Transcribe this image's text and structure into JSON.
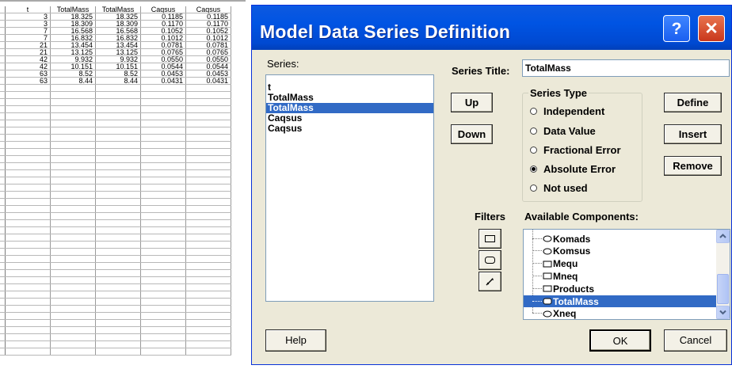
{
  "spreadsheet": {
    "headers": [
      "t",
      "TotalMass",
      "TotalMass",
      "Caqsus",
      "Caqsus"
    ],
    "rows": [
      [
        "3",
        "18.325",
        "18.325",
        "0.1185",
        "0.1185"
      ],
      [
        "3",
        "18.309",
        "18.309",
        "0.1170",
        "0.1170"
      ],
      [
        "7",
        "16.568",
        "16.568",
        "0.1052",
        "0.1052"
      ],
      [
        "7",
        "16.832",
        "16.832",
        "0.1012",
        "0.1012"
      ],
      [
        "21",
        "13.454",
        "13.454",
        "0.0781",
        "0.0781"
      ],
      [
        "21",
        "13.125",
        "13.125",
        "0.0765",
        "0.0765"
      ],
      [
        "42",
        "9.932",
        "9.932",
        "0.0550",
        "0.0550"
      ],
      [
        "42",
        "10.151",
        "10.151",
        "0.0544",
        "0.0544"
      ],
      [
        "63",
        "8.52",
        "8.52",
        "0.0453",
        "0.0453"
      ],
      [
        "63",
        "8.44",
        "8.44",
        "0.0431",
        "0.0431"
      ]
    ],
    "blank_rows": 38
  },
  "dialog": {
    "title": "Model Data Series Definition",
    "help_glyph": "?",
    "close_glyph": "✕",
    "title_color": "#0054e3",
    "close_color": "#d5482a",
    "series_label": "Series:",
    "series_items": [
      "t",
      "TotalMass",
      "TotalMass",
      "Caqsus",
      "Caqsus"
    ],
    "selected_series_index": 2,
    "up_label": "Up",
    "down_label": "Down",
    "series_title_label": "Series Title:",
    "series_title_value": "TotalMass",
    "series_type": {
      "label": "Series Type",
      "options": [
        "Independent",
        "Data Value",
        "Fractional Error",
        "Absolute Error",
        "Not used"
      ],
      "selected": "Absolute Error"
    },
    "define_label": "Define",
    "insert_label": "Insert",
    "remove_label": "Remove",
    "filters_label": "Filters",
    "filter_icons": [
      "rectangle-filter-icon",
      "rounded-rect-filter-icon",
      "arrow-filter-icon"
    ],
    "available_components_label": "Available Components:",
    "components": [
      {
        "name": "Komads",
        "icon": "ellipse-icon"
      },
      {
        "name": "Komsus",
        "icon": "ellipse-icon"
      },
      {
        "name": "Mequ",
        "icon": "rectangle-icon"
      },
      {
        "name": "Mneq",
        "icon": "rectangle-icon"
      },
      {
        "name": "Products",
        "icon": "rectangle-icon"
      },
      {
        "name": "TotalMass",
        "icon": "rounded-rect-icon",
        "selected": true
      },
      {
        "name": "Xneq",
        "icon": "ellipse-icon"
      }
    ],
    "help_label": "Help",
    "ok_label": "OK",
    "cancel_label": "Cancel",
    "selection_color": "#316ac5"
  }
}
